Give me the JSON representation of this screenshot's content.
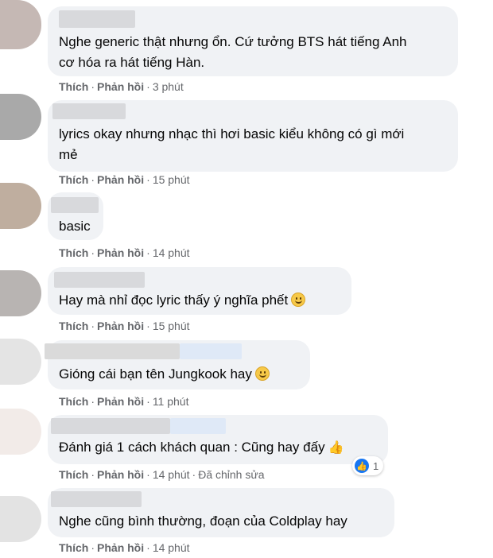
{
  "actions": {
    "like": "Thích",
    "reply": "Phản hồi",
    "dot": "·",
    "edited": "Đã chỉnh sửa"
  },
  "comments": [
    {
      "text": "Nghe generic thật nhưng ổn. Cứ tưởng BTS hát tiếng Anh",
      "text2": "cơ hóa ra hát tiếng Hàn.",
      "time": "3 phút"
    },
    {
      "text": "lyrics okay nhưng nhạc thì hơi basic kiểu không có gì mới",
      "text2": "mẻ",
      "time": "15 phút"
    },
    {
      "text": "basic",
      "time": "14 phút"
    },
    {
      "text": "Hay mà nhỉ đọc lyric thấy ý nghĩa phết",
      "emoji": "smile",
      "time": "15 phút"
    },
    {
      "text": "Gióng cái bạn tên Jungkook hay",
      "emoji": "smile",
      "time": "11 phút"
    },
    {
      "text": "Đánh giá 1 cách khách quan : Cũng hay đấy",
      "emoji": "thumbs-up",
      "time": "14 phút",
      "reaction": {
        "icon": "like-icon",
        "count": "1"
      }
    },
    {
      "text": "Nghe cũng bình thường, đoạn của Coldplay hay",
      "time": "14 phút"
    }
  ]
}
